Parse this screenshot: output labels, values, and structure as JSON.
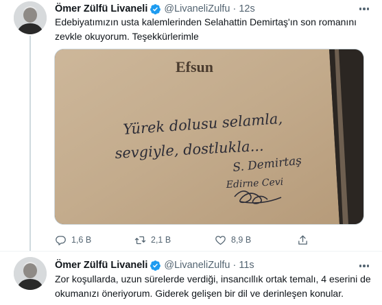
{
  "tweets": [
    {
      "author": "Ömer Zülfü Livaneli",
      "handle": "@LivaneliZulfu",
      "time": "12s",
      "text_lines": [
        "Edebiyatımızın usta kalemlerinden Selahattin Demirtaş'ın son romanını",
        "zevkle okuyorum.  Teşekkürlerimle"
      ],
      "image": {
        "book_title": "Efsun",
        "handwriting_line1": "Yürek dolusu selamla,",
        "handwriting_line2": "sevgiyle, dostlukla...",
        "signature_name": "S. Demirtaş",
        "signature_place": "Edirne Cevi"
      },
      "stats": {
        "replies": "1,6 B",
        "retweets": "2,1 B",
        "likes": "8,9 B"
      }
    },
    {
      "author": "Ömer Zülfü Livaneli",
      "handle": "@LivaneliZulfu",
      "time": "11s",
      "text_lines": [
        "Zor koşullarda, uzun sürelerde verdiği, insancıllık ortak temalı, 4 eserini de",
        "okumanızı öneriyorum. Giderek gelişen bir dil ve derinleşen konular."
      ]
    }
  ],
  "colors": {
    "verified": "#1d9bf0",
    "secondary_text": "#536471",
    "thread_line": "#cfd9de"
  },
  "icons": [
    "verified-badge-icon",
    "more-options-icon",
    "reply-icon",
    "retweet-icon",
    "like-icon",
    "share-icon"
  ]
}
